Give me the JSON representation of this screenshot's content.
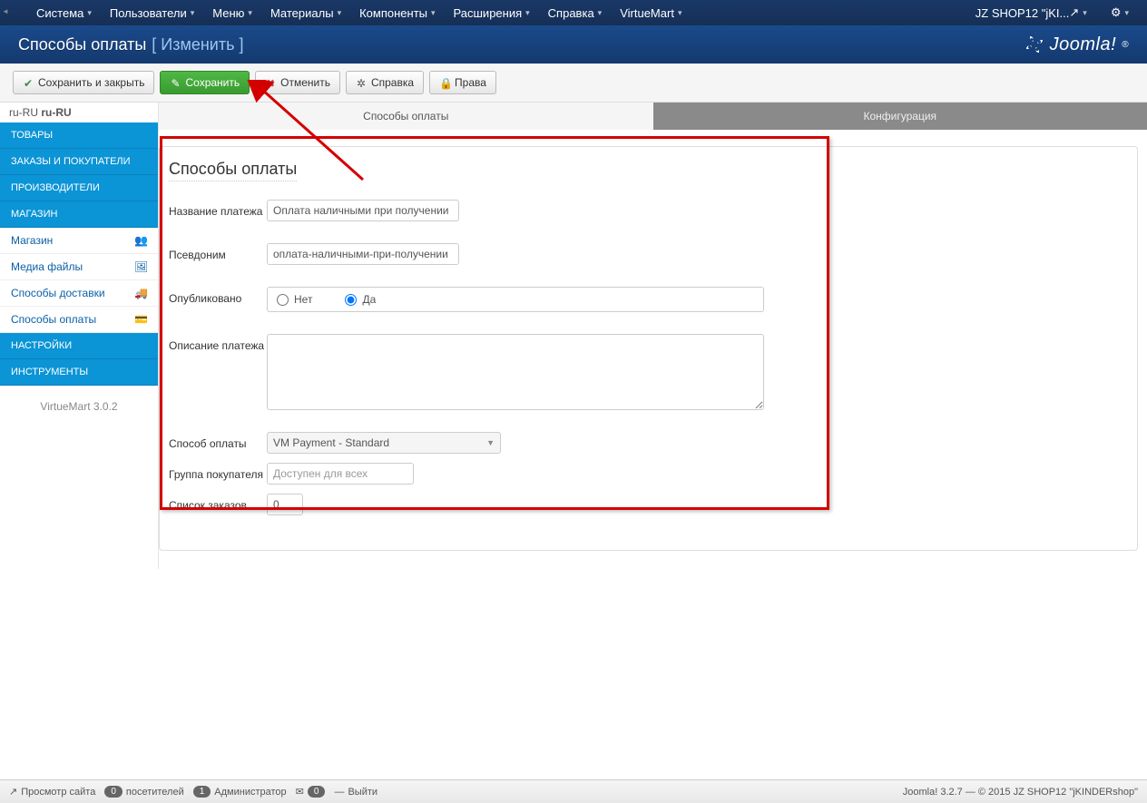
{
  "navbar": {
    "items": [
      "Система",
      "Пользователи",
      "Меню",
      "Материалы",
      "Компоненты",
      "Расширения",
      "Справка",
      "VirtueMart"
    ],
    "user_label": "JZ SHOP12 \"jKI..."
  },
  "titlebar": {
    "main": "Способы оплаты",
    "sub": "[ Изменить ]",
    "logo_text": "Joomla!"
  },
  "toolbar": {
    "save_close": "Сохранить и закрыть",
    "save": "Сохранить",
    "cancel": "Отменить",
    "help": "Справка",
    "rights": "Права"
  },
  "sidebar": {
    "locale_prefix": "ru-RU",
    "locale_bold": "ru-RU",
    "sections": {
      "tovary": "ТОВАРЫ",
      "orders": "ЗАКАЗЫ И ПОКУПАТЕЛИ",
      "manuf": "ПРОИЗВОДИТЕЛИ",
      "shop": "МАГАЗИН",
      "settings": "НАСТРОЙКИ",
      "tools": "ИНСТРУМЕНТЫ"
    },
    "links": {
      "shop": "Магазин",
      "media": "Медиа файлы",
      "shipping": "Способы доставки",
      "payment": "Способы оплаты"
    },
    "footer": "VirtueMart 3.0.2"
  },
  "tabs": {
    "tab1": "Способы оплаты",
    "tab2": "Конфигурация"
  },
  "form": {
    "heading": "Способы оплаты",
    "name_label": "Название платежа",
    "name_value": "Оплата наличными при получении",
    "alias_label": "Псевдоним",
    "alias_value": "оплата-наличными-при-получении",
    "pub_label": "Опубликовано",
    "pub_no": "Нет",
    "pub_yes": "Да",
    "desc_label": "Описание платежа",
    "desc_value": "",
    "method_label": "Способ оплаты",
    "method_value": "VM Payment - Standard",
    "group_label": "Группа покупателя",
    "group_placeholder": "Доступен для всех",
    "list_label": "Список заказов",
    "list_value": "0"
  },
  "statusbar": {
    "view_site": "Просмотр сайта",
    "visitors_count": "0",
    "visitors_label": "посетителей",
    "admin_count": "1",
    "admin_label": "Администратор",
    "msg_count": "0",
    "logout": "Выйти",
    "right": "Joomla! 3.2.7  —  © 2015 JZ SHOP12 \"jKINDERshop\""
  },
  "colors": {
    "accent_blue": "#0b94d6",
    "success_green": "#3fa43a",
    "annotation_red": "#d40000"
  }
}
